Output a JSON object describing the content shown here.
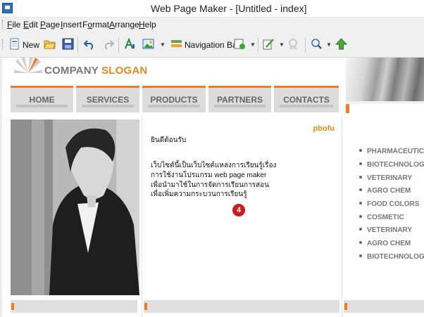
{
  "window": {
    "title": "Web Page Maker - [Untitled - index]"
  },
  "menu": [
    {
      "label": "File",
      "key": "F"
    },
    {
      "label": "Edit",
      "key": "E"
    },
    {
      "label": "Page",
      "key": "P"
    },
    {
      "label": "Insert",
      "key": "I"
    },
    {
      "label": "Format",
      "key": "o"
    },
    {
      "label": "Arrange",
      "key": "A"
    },
    {
      "label": "Help",
      "key": "H"
    }
  ],
  "toolbar": {
    "new_label": "New",
    "navbar_label": "Navigation Bar"
  },
  "page": {
    "company": {
      "name": "COMPANY",
      "slogan": "SLOGAN"
    },
    "nav": [
      "HOME",
      "SERVICES",
      "PRODUCTS",
      "PARTNERS",
      "CONTACTS"
    ],
    "content_tag": "pbofu",
    "welcome": "ยินดีต้อนรับ",
    "body_lines": [
      "เว็บไซต์นี้เป็นเว็บไซต์แหล่งการเรียนรู้เรื่อง",
      "การใช้งานโปรแกรม  web page maker",
      "เพื่อนำมาใช้ในการจัดการเรียนการสอน",
      "เพื่อเพิ่มความกระบวนการเรียนรู้"
    ],
    "badge": "4",
    "list": [
      "PHARMACEUTICAL",
      "BIOTECHNOLOGY",
      "VETERINARY",
      "AGRO CHEM",
      "FOOD COLORS",
      "COSMETIC",
      "VETERINARY",
      "AGRO CHEM",
      "BIOTECHNOLOGY"
    ]
  },
  "colors": {
    "accent": "#ee7c2b",
    "slogan": "#e48a1a",
    "badge": "#c81e1e"
  }
}
